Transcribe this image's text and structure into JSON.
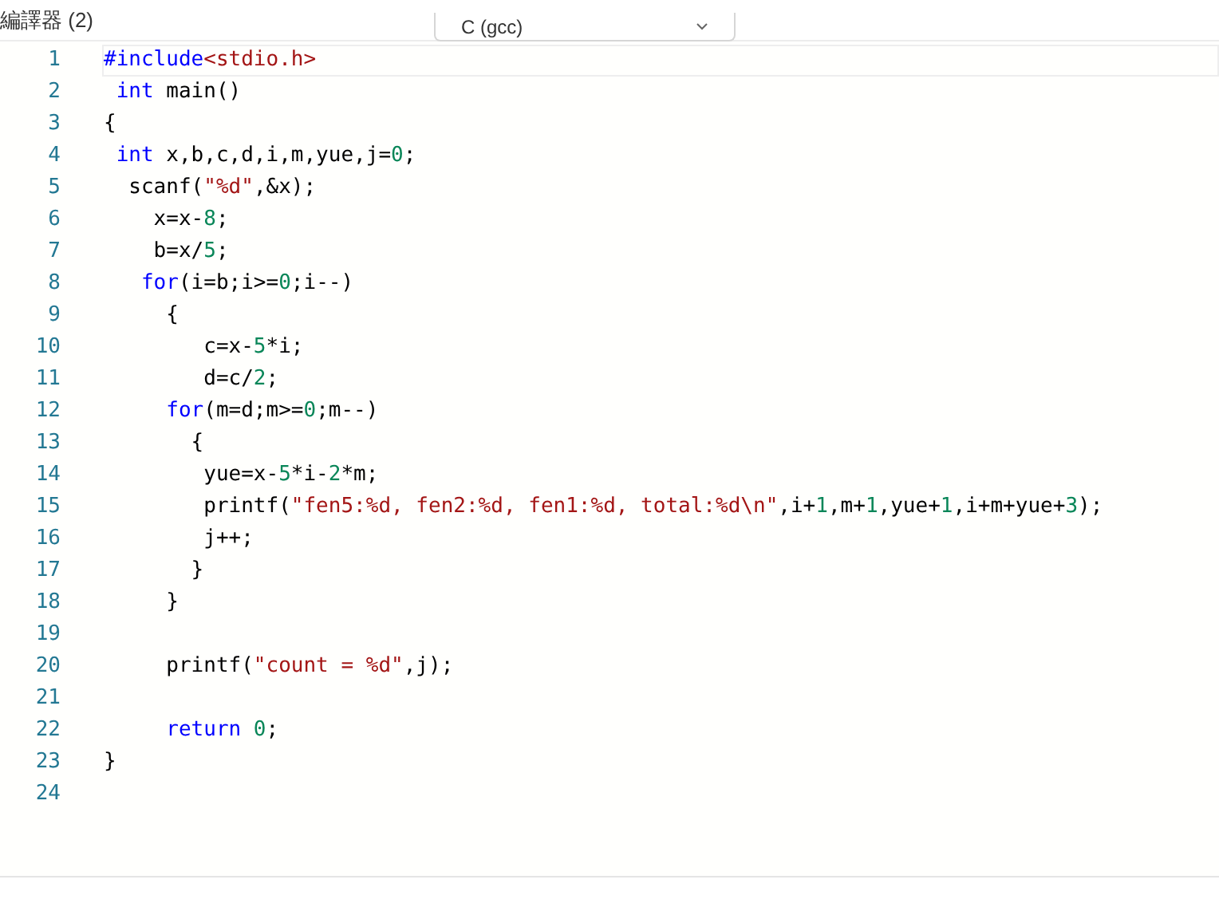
{
  "header": {
    "title": "編譯器 (2)",
    "language": "C (gcc)"
  },
  "editor": {
    "lines": [
      {
        "number": "1",
        "current": true,
        "tokens": [
          {
            "kind": "keyword",
            "text": "#include"
          },
          {
            "kind": "string",
            "text": "<stdio.h>"
          }
        ]
      },
      {
        "number": "2",
        "current": false,
        "tokens": [
          {
            "kind": "keyword",
            "text": " int"
          },
          {
            "kind": "plain",
            "text": " main()"
          }
        ]
      },
      {
        "number": "3",
        "current": false,
        "tokens": [
          {
            "kind": "plain",
            "text": "{"
          }
        ]
      },
      {
        "number": "4",
        "current": false,
        "tokens": [
          {
            "kind": "keyword",
            "text": " int"
          },
          {
            "kind": "plain",
            "text": " x,b,c,d,i,m,yue,j="
          },
          {
            "kind": "number",
            "text": "0"
          },
          {
            "kind": "plain",
            "text": ";"
          }
        ]
      },
      {
        "number": "5",
        "current": false,
        "tokens": [
          {
            "kind": "plain",
            "text": "  scanf("
          },
          {
            "kind": "string",
            "text": "\"%d\""
          },
          {
            "kind": "plain",
            "text": ",&x);"
          }
        ]
      },
      {
        "number": "6",
        "current": false,
        "tokens": [
          {
            "kind": "plain",
            "text": "    x=x-"
          },
          {
            "kind": "number",
            "text": "8"
          },
          {
            "kind": "plain",
            "text": ";"
          }
        ]
      },
      {
        "number": "7",
        "current": false,
        "tokens": [
          {
            "kind": "plain",
            "text": "    b=x/"
          },
          {
            "kind": "number",
            "text": "5"
          },
          {
            "kind": "plain",
            "text": ";"
          }
        ]
      },
      {
        "number": "8",
        "current": false,
        "tokens": [
          {
            "kind": "keyword",
            "text": "   for"
          },
          {
            "kind": "plain",
            "text": "(i=b;i>="
          },
          {
            "kind": "number",
            "text": "0"
          },
          {
            "kind": "plain",
            "text": ";i--)"
          }
        ]
      },
      {
        "number": "9",
        "current": false,
        "tokens": [
          {
            "kind": "plain",
            "text": "     {"
          }
        ]
      },
      {
        "number": "10",
        "current": false,
        "tokens": [
          {
            "kind": "plain",
            "text": "        c=x-"
          },
          {
            "kind": "number",
            "text": "5"
          },
          {
            "kind": "plain",
            "text": "*i;"
          }
        ]
      },
      {
        "number": "11",
        "current": false,
        "tokens": [
          {
            "kind": "plain",
            "text": "        d=c/"
          },
          {
            "kind": "number",
            "text": "2"
          },
          {
            "kind": "plain",
            "text": ";"
          }
        ]
      },
      {
        "number": "12",
        "current": false,
        "tokens": [
          {
            "kind": "keyword",
            "text": "     for"
          },
          {
            "kind": "plain",
            "text": "(m=d;m>="
          },
          {
            "kind": "number",
            "text": "0"
          },
          {
            "kind": "plain",
            "text": ";m--)"
          }
        ]
      },
      {
        "number": "13",
        "current": false,
        "tokens": [
          {
            "kind": "plain",
            "text": "       {"
          }
        ]
      },
      {
        "number": "14",
        "current": false,
        "tokens": [
          {
            "kind": "plain",
            "text": "        yue=x-"
          },
          {
            "kind": "number",
            "text": "5"
          },
          {
            "kind": "plain",
            "text": "*i-"
          },
          {
            "kind": "number",
            "text": "2"
          },
          {
            "kind": "plain",
            "text": "*m;"
          }
        ]
      },
      {
        "number": "15",
        "current": false,
        "tokens": [
          {
            "kind": "plain",
            "text": "        printf("
          },
          {
            "kind": "string",
            "text": "\"fen5:%d, fen2:%d, fen1:%d, total:%d\\n\""
          },
          {
            "kind": "plain",
            "text": ",i+"
          },
          {
            "kind": "number",
            "text": "1"
          },
          {
            "kind": "plain",
            "text": ",m+"
          },
          {
            "kind": "number",
            "text": "1"
          },
          {
            "kind": "plain",
            "text": ",yue+"
          },
          {
            "kind": "number",
            "text": "1"
          },
          {
            "kind": "plain",
            "text": ",i+m+yue+"
          },
          {
            "kind": "number",
            "text": "3"
          },
          {
            "kind": "plain",
            "text": ");"
          }
        ]
      },
      {
        "number": "16",
        "current": false,
        "tokens": [
          {
            "kind": "plain",
            "text": "        j++;"
          }
        ]
      },
      {
        "number": "17",
        "current": false,
        "tokens": [
          {
            "kind": "plain",
            "text": "       }"
          }
        ]
      },
      {
        "number": "18",
        "current": false,
        "tokens": [
          {
            "kind": "plain",
            "text": "     }"
          }
        ]
      },
      {
        "number": "19",
        "current": false
      },
      {
        "number": "20",
        "current": false,
        "tokens": [
          {
            "kind": "plain",
            "text": "     printf("
          },
          {
            "kind": "string",
            "text": "\"count = %d\""
          },
          {
            "kind": "plain",
            "text": ",j);"
          }
        ]
      },
      {
        "number": "21",
        "current": false
      },
      {
        "number": "22",
        "current": false,
        "tokens": [
          {
            "kind": "keyword",
            "text": "     return"
          },
          {
            "kind": "number",
            "text": " 0"
          },
          {
            "kind": "plain",
            "text": ";"
          }
        ]
      },
      {
        "number": "23",
        "current": false,
        "tokens": [
          {
            "kind": "plain",
            "text": "}"
          }
        ]
      },
      {
        "number": "24",
        "current": false
      }
    ]
  }
}
